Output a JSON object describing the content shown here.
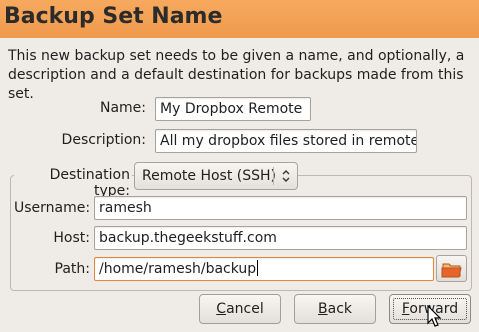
{
  "header": {
    "title": "Backup Set Name"
  },
  "intro": {
    "text": "This new backup set needs to be given a name, and optionally, a description and a default destination for backups made from this set."
  },
  "form": {
    "name_label": "Name:",
    "name_value": "My Dropbox Remote",
    "description_label": "Description:",
    "description_value": "All my dropbox files stored in remote s"
  },
  "destination": {
    "type_label": "Destination type:",
    "type_value": "Remote Host (SSH)",
    "username_label": "Username:",
    "username_value": "ramesh",
    "host_label": "Host:",
    "host_value": "backup.thegeekstuff.com",
    "path_label": "Path:",
    "path_value": "/home/ramesh/backup"
  },
  "buttons": {
    "cancel_first": "C",
    "cancel_rest": "ancel",
    "back_first": "B",
    "back_rest": "ack",
    "forward_first": "F",
    "forward_rest": "orward"
  },
  "icons": {
    "folder": "folder-open-icon",
    "combo_arrow": "up-down-arrow-icon",
    "cursor": "mouse-pointer-icon"
  },
  "colors": {
    "header": "#ef9a4c",
    "focus_border": "#e6863b",
    "folder": "#e8642a"
  }
}
